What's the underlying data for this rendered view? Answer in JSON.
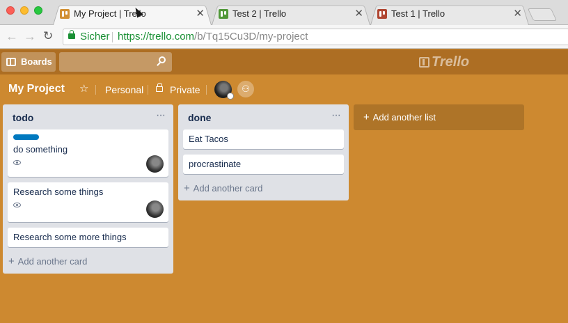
{
  "browser": {
    "tabs": [
      {
        "title": "My Project | Trello",
        "close": "✕",
        "favicon_color": "#d29034",
        "active": true
      },
      {
        "title": "Test 2 | Trello",
        "close": "✕",
        "favicon_color": "#519839",
        "active": false
      },
      {
        "title": "Test 1 | Trello",
        "close": "✕",
        "favicon_color": "#b04632",
        "active": false
      }
    ],
    "nav": {
      "back": "←",
      "forward": "→",
      "reload": "↻"
    },
    "address": {
      "secure_label": "Sicher",
      "scheme_host": "https://trello.com",
      "path": "/b/Tq15Cu3D/my-project"
    }
  },
  "header": {
    "boards_label": "Boards",
    "search_placeholder": "",
    "logo_text": "Trello"
  },
  "board": {
    "title": "My Project",
    "star_glyph": "☆",
    "team_label": "Personal",
    "privacy_label": "Private",
    "invite_glyph": "⚇"
  },
  "lists": [
    {
      "title": "todo",
      "menu": "···",
      "cards": [
        {
          "title": "do something",
          "has_label": true,
          "label_color": "#0079bf",
          "watching": true,
          "has_member": true
        },
        {
          "title": "Research some things",
          "has_label": false,
          "watching": true,
          "has_member": true
        },
        {
          "title": "Research some more things",
          "has_label": false,
          "watching": false,
          "has_member": false
        }
      ],
      "add_card": "Add another card"
    },
    {
      "title": "done",
      "menu": "···",
      "cards": [
        {
          "title": "Eat Tacos"
        },
        {
          "title": "procrastinate"
        }
      ],
      "add_card": "Add another card"
    }
  ],
  "add_list_label": "Add another list",
  "colors": {
    "board_bg": "#cd8930",
    "header_bg": "#ad6e23",
    "list_bg": "#dfe1e6"
  }
}
